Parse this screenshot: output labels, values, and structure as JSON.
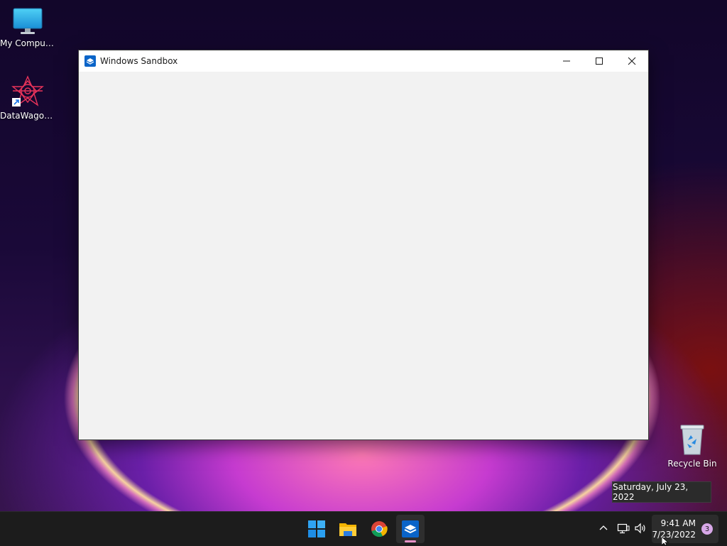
{
  "desktop": {
    "icons": [
      {
        "label": "My Computer"
      },
      {
        "label": "DataWagon..."
      },
      {
        "label": "Recycle Bin"
      }
    ]
  },
  "window": {
    "title": "Windows Sandbox",
    "buttons": {
      "minimize": "minimize",
      "maximize": "maximize",
      "close": "close"
    }
  },
  "tooltip": {
    "text": "Saturday, July 23, 2022"
  },
  "taskbar": {
    "apps": [
      "start-icon",
      "file-explorer-icon",
      "chrome-icon",
      "windows-sandbox-icon"
    ],
    "clock": {
      "time": "9:41 AM",
      "date": "7/23/2022"
    },
    "notifications": {
      "count": "3"
    }
  },
  "colors": {
    "accent": "#0078d4",
    "sandbox_active_indicator": "#e892c8"
  }
}
